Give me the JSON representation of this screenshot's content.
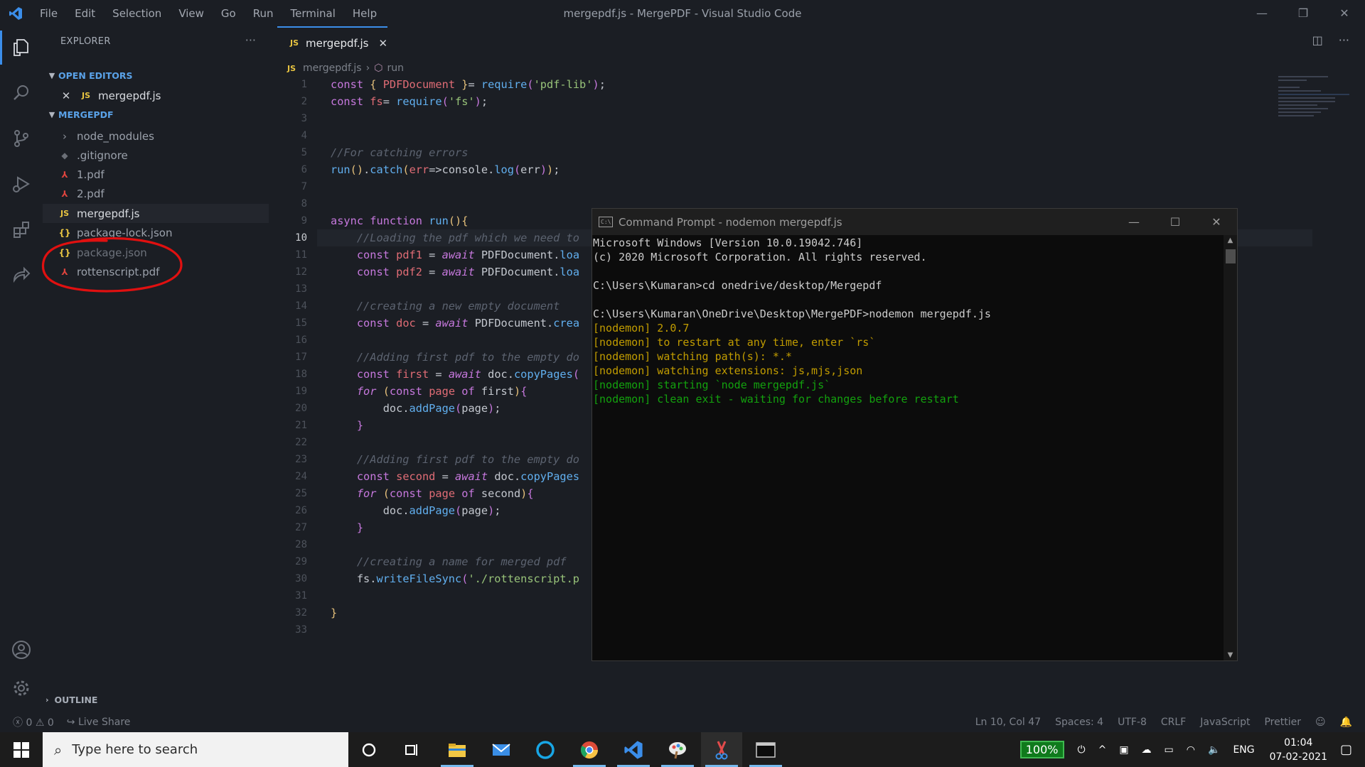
{
  "titlebar": {
    "menu": [
      "File",
      "Edit",
      "Selection",
      "View",
      "Go",
      "Run",
      "Terminal",
      "Help"
    ],
    "window_title": "mergepdf.js - MergePDF - Visual Studio Code"
  },
  "sidebar": {
    "header": "EXPLORER",
    "more": "···",
    "open_editors_title": "OPEN EDITORS",
    "open_editor_item": "mergepdf.js",
    "project_title": "MERGEPDF",
    "files": [
      {
        "name": "node_modules",
        "icon": "›"
      },
      {
        "name": ".gitignore",
        "icon": "◆"
      },
      {
        "name": "1.pdf",
        "icon": "⅄"
      },
      {
        "name": "2.pdf",
        "icon": "⅄"
      },
      {
        "name": "mergepdf.js",
        "icon": "JS"
      },
      {
        "name": "package-lock.json",
        "icon": "{}"
      },
      {
        "name": "package.json",
        "icon": "{}"
      },
      {
        "name": "rottenscript.pdf",
        "icon": "⅄"
      }
    ],
    "outline_title": "OUTLINE"
  },
  "editor": {
    "tab_label": "mergepdf.js",
    "tab_icon": "JS",
    "breadcrumb_file": "mergepdf.js",
    "breadcrumb_symbol": "run",
    "cursor_line": 10
  },
  "terminal": {
    "title": "Command Prompt - nodemon  mergepdf.js",
    "lines": [
      "Microsoft Windows [Version 10.0.19042.746]",
      "(c) 2020 Microsoft Corporation. All rights reserved.",
      "",
      "C:\\Users\\Kumaran>cd onedrive/desktop/Mergepdf",
      "",
      "C:\\Users\\Kumaran\\OneDrive\\Desktop\\MergePDF>nodemon mergepdf.js",
      "[nodemon] 2.0.7",
      "[nodemon] to restart at any time, enter `rs`",
      "[nodemon] watching path(s): *.*",
      "[nodemon] watching extensions: js,mjs,json",
      "[nodemon] starting `node mergepdf.js`",
      "[nodemon] clean exit - waiting for changes before restart"
    ]
  },
  "statusbar": {
    "errors": "0",
    "warnings": "0",
    "live_share": "Live Share",
    "position": "Ln 10, Col 47",
    "spaces": "Spaces: 4",
    "encoding": "UTF-8",
    "eol": "CRLF",
    "language": "JavaScript",
    "formatter": "Prettier"
  },
  "taskbar": {
    "search_placeholder": "Type here to search",
    "battery": "100%",
    "language": "ENG",
    "time": "01:04",
    "date": "07-02-2021"
  },
  "colors": {
    "accent": "#3b8eea",
    "annotation": "#e01010"
  }
}
